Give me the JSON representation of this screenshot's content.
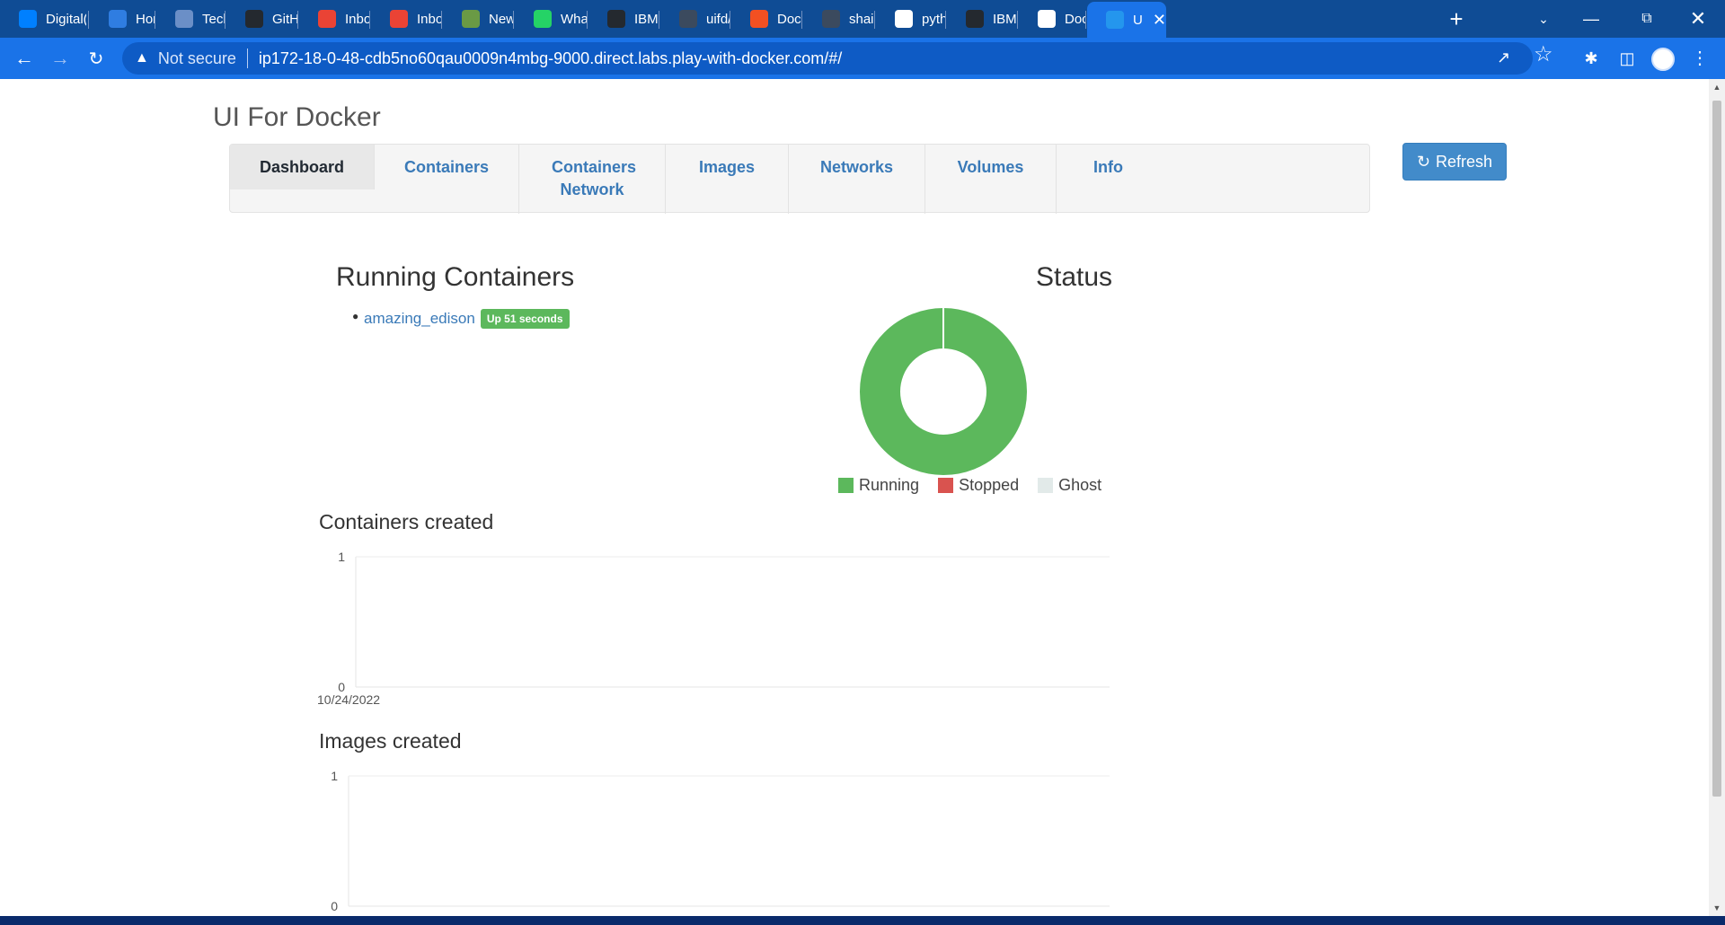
{
  "browser": {
    "tabs": [
      {
        "title": "Digital(",
        "icon": "digitalocean-icon",
        "color": "#0080ff"
      },
      {
        "title": "Home -",
        "icon": "azure-icon",
        "color": "#2f7de1"
      },
      {
        "title": "Tech Ca",
        "icon": "techcamp-icon",
        "color": "#6b8fc7"
      },
      {
        "title": "GitHub",
        "icon": "github-icon",
        "color": "#24292f"
      },
      {
        "title": "Inbox -",
        "icon": "gmail-icon",
        "color": "#ea4335"
      },
      {
        "title": "Inbox -",
        "icon": "gmail-icon",
        "color": "#ea4335"
      },
      {
        "title": "New Ta",
        "icon": "new-tab-icon",
        "color": "#6a9a45"
      },
      {
        "title": "WhatsA",
        "icon": "whatsapp-icon",
        "color": "#25d366"
      },
      {
        "title": "IBM-Pr",
        "icon": "github-icon",
        "color": "#24292f"
      },
      {
        "title": "uifd/ui-",
        "icon": "docker-hub-icon",
        "color": "#3b4a5e"
      },
      {
        "title": "Docker",
        "icon": "microsoft-icon",
        "color": "#f25022"
      },
      {
        "title": "shaikas",
        "icon": "profile-icon",
        "color": "#3b4a5e"
      },
      {
        "title": "python",
        "icon": "google-icon",
        "color": "#ffffff"
      },
      {
        "title": "IBM-Pr",
        "icon": "github-icon",
        "color": "#24292f"
      },
      {
        "title": "Docker",
        "icon": "globe-icon",
        "color": "#ffffff"
      },
      {
        "title": "UI F",
        "icon": "docker-ui-icon",
        "color": "#2496ed"
      }
    ],
    "address": {
      "security": "Not secure",
      "url": "ip172-18-0-48-cdb5no60qau0009n4mbg-9000.direct.labs.play-with-docker.com/#/"
    }
  },
  "app": {
    "title": "UI For Docker",
    "nav": [
      {
        "label": "Dashboard",
        "active": true
      },
      {
        "label": "Containers",
        "active": false
      },
      {
        "label": "Containers Network",
        "active": false
      },
      {
        "label": "Images",
        "active": false
      },
      {
        "label": "Networks",
        "active": false
      },
      {
        "label": "Volumes",
        "active": false
      },
      {
        "label": "Info",
        "active": false
      }
    ],
    "refresh_label": "Refresh"
  },
  "running": {
    "title": "Running Containers",
    "containers": [
      {
        "name": "amazing_edison",
        "status": "Up 51 seconds"
      }
    ]
  },
  "status": {
    "title": "Status",
    "legend": [
      {
        "label": "Running",
        "color": "#5cb85c"
      },
      {
        "label": "Stopped",
        "color": "#d9534f"
      },
      {
        "label": "Ghost",
        "color": "#e2eae9"
      }
    ]
  },
  "containers_created": {
    "title": "Containers created"
  },
  "images_created": {
    "title": "Images created"
  },
  "chart_data": [
    {
      "type": "pie",
      "title": "Status",
      "categories": [
        "Running",
        "Stopped",
        "Ghost"
      ],
      "values": [
        1,
        0,
        0
      ],
      "colors": [
        "#5cb85c",
        "#d9534f",
        "#e2eae9"
      ],
      "legend": "bottom"
    },
    {
      "type": "line",
      "title": "Containers created",
      "x": [
        "10/24/2022"
      ],
      "y": [],
      "ylim": [
        0,
        1
      ],
      "yticks": [
        "1",
        "0"
      ],
      "xticks": [
        "10/24/2022"
      ],
      "grid": true
    },
    {
      "type": "line",
      "title": "Images created",
      "y": [],
      "ylim": [
        0,
        1
      ],
      "yticks": [
        "1",
        "0"
      ],
      "grid": true
    }
  ]
}
